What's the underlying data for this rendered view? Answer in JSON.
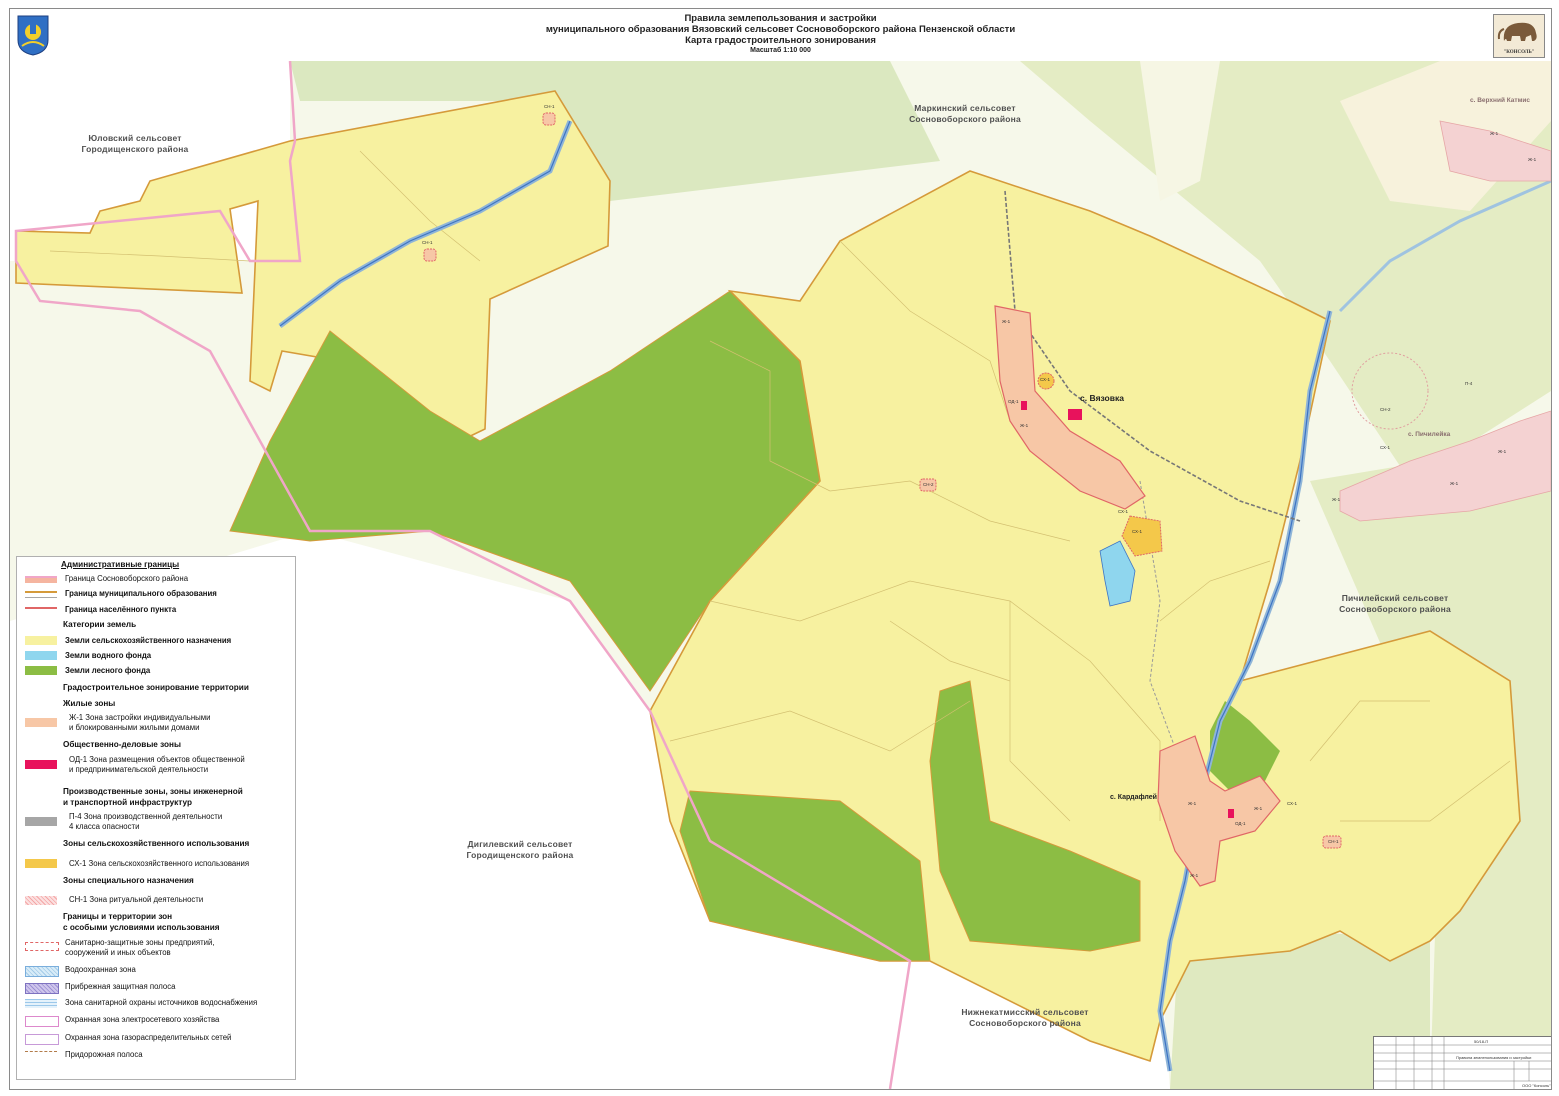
{
  "title": {
    "line1": "Правила землепользования и застройки",
    "line2": "муниципального образования Вязовский сельсовет Сосновоборского района Пензенской области",
    "line3": "Карта градостроительного зонирования",
    "scale": "Масштаб 1:10 000"
  },
  "logo_text": "\"КОНСОЛЬ\"",
  "neighbors": {
    "yulovsky": [
      "Юловский сельсовет",
      "Городищенского района"
    ],
    "markinsky": [
      "Маркинский сельсовет",
      "Сосновоборского района"
    ],
    "pichileysky": [
      "Пичилейский сельсовет",
      "Сосновоборского района"
    ],
    "digilevsky": [
      "Дигилевский сельсовет",
      "Городищенского района"
    ],
    "nizhnekatmissky": [
      "Нижнекатмисский сельсовет",
      "Сосновоборского района"
    ]
  },
  "places": {
    "vyazovka": "с. Вязовка",
    "kardafley": "с. Кардафлей",
    "verkhny_katmis": "с. Верхний Катмис",
    "pichileyka": "с. Пичилейка"
  },
  "zone_labels": {
    "zh1": "Ж-1",
    "od1": "ОД-1",
    "sh1": "СХ-1",
    "sn1": "СН-1",
    "sn2": "СН-2",
    "p4": "П-4"
  },
  "legend": {
    "admin_header": "Административные границы",
    "rayon_border": "Граница Сосновоборского района",
    "mo_border": "Граница муниципального образования",
    "np_border": "Граница населённого пункта",
    "land_header": "Категории земель",
    "agri": "Земли сельскохозяйственного назначения",
    "water": "Земли водного фонда",
    "forest": "Земли лесного фонда",
    "zoning_header": "Градостроительное зонирование территории",
    "res_header": "Жилые зоны",
    "zh1_1": "Ж-1 Зона застройки индивидуальными",
    "zh1_2": "и блокированными жилыми домами",
    "pub_header": "Общественно-деловые зоны",
    "od1_1": "ОД-1 Зона размещения объектов общественной",
    "od1_2": "и предпринимательской деятельности",
    "prod_header_1": "Производственные зоны, зоны инженерной",
    "prod_header_2": "и транспортной инфраструктур",
    "p4_1": "П-4 Зона производственной деятельности",
    "p4_2": "4 класса опасности",
    "agruse_header": "Зоны сельскохозяйственного использования",
    "sh1": "СХ-1 Зона сельскохозяйственного использования",
    "special_header": "Зоны специального назначения",
    "sn1": "СН-1 Зона ритуальной деятельности",
    "lim_header_1": "Границы и территории зон",
    "lim_header_2": "с особыми условиями использования",
    "szz_1": "Санитарно-защитные зоны предприятий,",
    "szz_2": "сооружений и иных объектов",
    "vodoohr": "Водоохранная зона",
    "pribr": "Прибрежная защитная полоса",
    "zso": "Зона санитарной охраны источников водоснабжения",
    "electro": "Охранная зона электросетевого хозяйства",
    "gas": "Охранная зона газораспределительных сетей",
    "road": "Придорожная полоса"
  },
  "stamp": {
    "code": "50/18-П",
    "title": "Правила землепользования и застройки",
    "org": "ООО \"Консоль\""
  },
  "colors": {
    "agri": "#f7f1a0",
    "forest": "#8cbd44",
    "water": "#8fd6ee",
    "zh1": "#f7c7a6",
    "od1": "#e8125c",
    "p4": "#a6a6a6",
    "sh1": "#f4c84a",
    "external": "#e6eec2",
    "border": "#d59a3a"
  }
}
